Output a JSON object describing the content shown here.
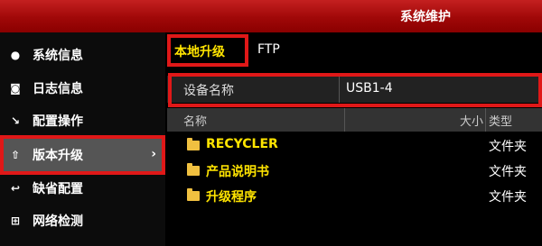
{
  "window": {
    "title": "系统维护"
  },
  "sidebar": {
    "items": [
      {
        "icon": "info-icon",
        "glyph": "●",
        "label": "系统信息"
      },
      {
        "icon": "log-icon",
        "glyph": "◙",
        "label": "日志信息"
      },
      {
        "icon": "config-icon",
        "glyph": "↘",
        "label": "配置操作"
      },
      {
        "icon": "upgrade-icon",
        "glyph": "⇧",
        "label": "版本升级",
        "active": true
      },
      {
        "icon": "default-icon",
        "glyph": "↩",
        "label": "缺省配置"
      },
      {
        "icon": "network-icon",
        "glyph": "⊞",
        "label": "网络检测"
      }
    ],
    "active_chevron": "›"
  },
  "tabs": {
    "local": "本地升级",
    "ftp": "FTP"
  },
  "device": {
    "label": "设备名称",
    "value": "USB1-4"
  },
  "table": {
    "headers": {
      "name": "名称",
      "size": "大小",
      "type": "类型"
    },
    "rows": [
      {
        "name": "RECYCLER",
        "type": "文件夹"
      },
      {
        "name": "产品说明书",
        "type": "文件夹"
      },
      {
        "name": "升级程序",
        "type": "文件夹"
      }
    ]
  },
  "colors": {
    "accent": "#e01818",
    "highlight_text": "#ffe400",
    "titlebar": "#b00d0d"
  }
}
